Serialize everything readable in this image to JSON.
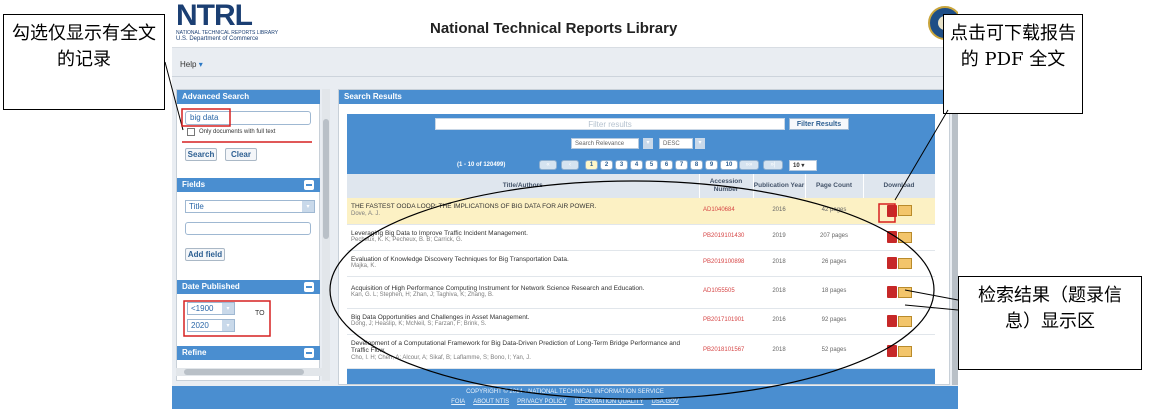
{
  "header": {
    "logo": {
      "big": "NTRL",
      "line1": "NATIONAL TECHNICAL REPORTS LIBRARY",
      "line2": "U.S. Department of Commerce"
    },
    "title": "National Technical Reports Library",
    "help": "Help"
  },
  "sidebar": {
    "advanced_search": "Advanced Search",
    "search_value": "big data",
    "fulltext_label": "Only documents with full text",
    "search_btn": "Search",
    "clear_btn": "Clear",
    "fields_title": "Fields",
    "field_select": "Title",
    "add_field": "Add field",
    "date_title": "Date Published",
    "date_from": "<1900",
    "date_to": "2020",
    "to_label": "TO",
    "refine_title": "Refine"
  },
  "results": {
    "title": "Search Results",
    "filter_placeholder": "Filter results",
    "filter_btn": "Filter Results",
    "sort": "Search Relevance",
    "order": "DESC",
    "count": "(1 - 10 of 120499)",
    "pages": [
      "1",
      "2",
      "3",
      "4",
      "5",
      "6",
      "7",
      "8",
      "9",
      "10"
    ],
    "per_page": "10",
    "nav": {
      "first": "«",
      "prev": "‹",
      "next": "»»",
      "last": "»|"
    },
    "columns": [
      "Title/Authors",
      "Accession Number",
      "Publication Year",
      "Page Count",
      "Download"
    ],
    "rows": [
      {
        "title": "THE FASTEST OODA LOOP: THE IMPLICATIONS OF BIG DATA FOR AIR POWER.",
        "authors": "Dove, A. J.",
        "acc": "AD1040684",
        "year": "2016",
        "pages": "42 pages"
      },
      {
        "title": "Leveraging Big Data to Improve Traffic Incident Management.",
        "authors": "Pecheux, K. K; Pecheux, B. B; Carrick, G.",
        "acc": "PB2019101430",
        "year": "2019",
        "pages": "207 pages"
      },
      {
        "title": "Evaluation of Knowledge Discovery Techniques for Big Transportation Data.",
        "authors": "Majka, K.",
        "acc": "PB2019100898",
        "year": "2018",
        "pages": "26 pages"
      },
      {
        "title": "Acquisition of High Performance Computing Instrument for Network Science Research and Education.",
        "authors": "Kan, G. L; Stephen, H; Zhan, J; Taghiva, K; Zhang, B.",
        "acc": "AD1055505",
        "year": "2018",
        "pages": "18 pages"
      },
      {
        "title": "Big Data Opportunities and Challenges in Asset Management.",
        "authors": "Dong, J; Heaslip, K; McNeil, S; Farzan, F; Brink, S.",
        "acc": "PB2017101901",
        "year": "2016",
        "pages": "92 pages"
      },
      {
        "title": "Development of a Computational Framework for Big Data-Driven Prediction of Long-Term Bridge Performance and Traffic Flow.",
        "authors": "Cho, I. H; Chen, A; Alcour, A; Sikaf, B; Laflamme, S; Bono, I; Yan, J.",
        "acc": "PB2018101567",
        "year": "2018",
        "pages": "52 pages"
      }
    ]
  },
  "footer": {
    "copyright": "COPYRIGHT © 2014 - NATIONAL TECHNICAL INFORMATION SERVICE",
    "links": [
      "FOIA",
      "ABOUT NTIS",
      "PRIVACY POLICY",
      "INFORMATION QUALITY",
      "USA.GOV"
    ]
  },
  "annotations": {
    "left": "勾选仅显示有全文的记录",
    "right_top": "点击可下载报告的 PDF 全文",
    "right_bottom": "检索结果（题录信息）显示区"
  }
}
